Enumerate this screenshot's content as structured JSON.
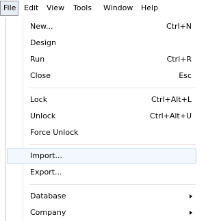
{
  "menubar": {
    "items": [
      {
        "label": "File"
      },
      {
        "label": "Edit"
      },
      {
        "label": "View"
      },
      {
        "label": "Tools"
      },
      {
        "label": "Window"
      },
      {
        "label": "Help"
      }
    ]
  },
  "file_menu": {
    "groups": [
      [
        {
          "label": "New...",
          "shortcut": "Ctrl+N"
        },
        {
          "label": "Design",
          "shortcut": ""
        },
        {
          "label": "Run",
          "shortcut": "Ctrl+R"
        },
        {
          "label": "Close",
          "shortcut": "Esc"
        }
      ],
      [
        {
          "label": "Lock",
          "shortcut": "Ctrl+Alt+L"
        },
        {
          "label": "Unlock",
          "shortcut": "Ctrl+Alt+U"
        },
        {
          "label": "Force Unlock",
          "shortcut": ""
        }
      ],
      [
        {
          "label": "Import...",
          "shortcut": ""
        },
        {
          "label": "Export...",
          "shortcut": ""
        }
      ],
      [
        {
          "label": "Database",
          "submenu": true
        },
        {
          "label": "Company",
          "submenu": true
        }
      ]
    ],
    "highlighted": "Import..."
  }
}
